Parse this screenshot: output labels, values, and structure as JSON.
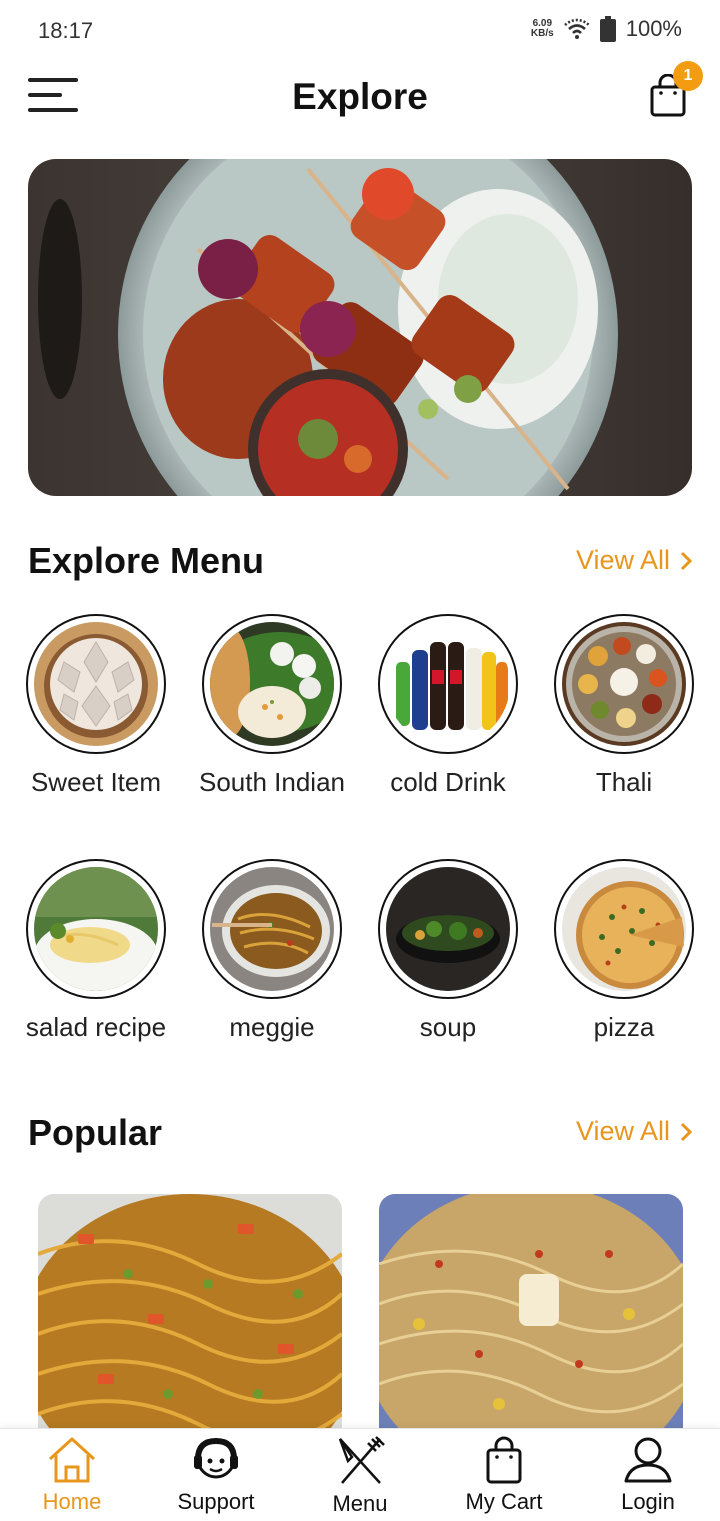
{
  "status_bar": {
    "time": "18:17",
    "net_speed_value": "6.09",
    "net_speed_unit": "KB/s",
    "battery": "100%"
  },
  "header": {
    "title": "Explore",
    "cart_badge": "1"
  },
  "explore_menu": {
    "title": "Explore Menu",
    "view_all": "View All",
    "categories": [
      {
        "label": "Sweet Item"
      },
      {
        "label": "South Indian"
      },
      {
        "label": "cold Drink"
      },
      {
        "label": "Thali"
      },
      {
        "label": "salad recipe"
      },
      {
        "label": "meggie"
      },
      {
        "label": "soup"
      },
      {
        "label": "pizza"
      }
    ]
  },
  "popular": {
    "title": "Popular",
    "view_all": "View All"
  },
  "bottom_nav": {
    "items": [
      {
        "label": "Home",
        "icon": "home-icon",
        "active": true
      },
      {
        "label": "Support",
        "icon": "support-agent-icon",
        "active": false
      },
      {
        "label": "Menu",
        "icon": "fork-knife-icon",
        "active": false
      },
      {
        "label": "My Cart",
        "icon": "shopping-bag-icon",
        "active": false
      },
      {
        "label": "Login",
        "icon": "user-icon",
        "active": false
      }
    ]
  },
  "colors": {
    "accent": "#e8961c",
    "badge": "#f39c12"
  }
}
